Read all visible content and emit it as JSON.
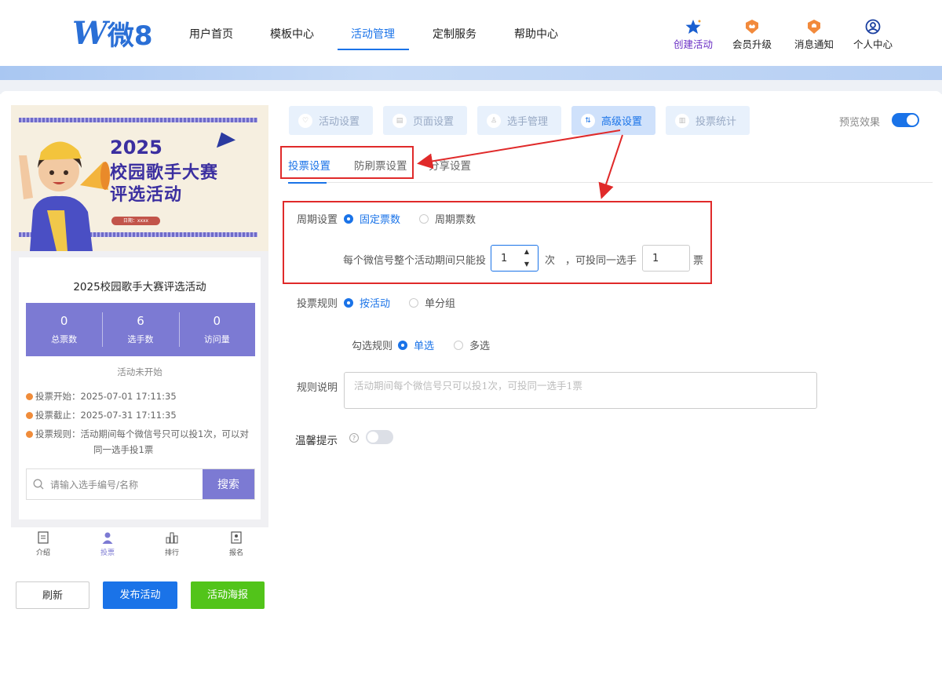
{
  "brand": {
    "logo_w": "W",
    "logo_text": "微8"
  },
  "nav": {
    "links": [
      "用户首页",
      "模板中心",
      "活动管理",
      "定制服务",
      "帮助中心"
    ],
    "active": "活动管理",
    "icons": [
      {
        "label": "创建活动",
        "icon": "star-icon"
      },
      {
        "label": "会员升级",
        "icon": "crown-badge-icon"
      },
      {
        "label": "消息通知",
        "icon": "bell-badge-icon"
      },
      {
        "label": "个人中心",
        "icon": "user-icon"
      }
    ]
  },
  "preview": {
    "poster": {
      "line1": "2025",
      "line2": "校园歌手大赛",
      "line3": "评选活动",
      "date": "日期：xxxx"
    },
    "title": "2025校园歌手大赛评选活动",
    "stats": [
      {
        "num": "0",
        "label": "总票数"
      },
      {
        "num": "6",
        "label": "选手数"
      },
      {
        "num": "0",
        "label": "访问量"
      }
    ],
    "status": "活动未开始",
    "meta": {
      "start": "投票开始：2025-07-01 17:11:35",
      "end": "投票截止：2025-07-31 17:11:35",
      "rule_a": "投票规则：活动期间每个微信号只可以投1次，可以对",
      "rule_b": "同一选手投1票"
    },
    "search_placeholder": "请输入选手编号/名称",
    "search_button": "搜索",
    "tabbar": [
      "介绍",
      "投票",
      "排行",
      "报名"
    ]
  },
  "buttons": {
    "refresh": "刷新",
    "publish": "发布活动",
    "poster": "活动海报"
  },
  "colors": {
    "accent": "#1a73e8",
    "purple": "#7c7ad3",
    "green": "#52c41a",
    "red": "#e02a2a"
  },
  "steps": [
    "活动设置",
    "页面设置",
    "选手管理",
    "高级设置",
    "投票统计"
  ],
  "steps_active": "高级设置",
  "preview_toggle": {
    "label": "预览效果",
    "on": true
  },
  "subtabs": [
    "投票设置",
    "防刷票设置",
    "分享设置"
  ],
  "form": {
    "cycle_label": "周期设置",
    "cycle_options": [
      "固定票数",
      "周期票数"
    ],
    "limit_prefix": "每个微信号整个活动期间只能投",
    "limit_value": "1",
    "limit_unit": "次",
    "same_prefix": "，可投同一选手",
    "same_value": "1",
    "same_unit": "票",
    "rule_label": "投票规则",
    "rule_options": [
      "按活动",
      "单分组"
    ],
    "check_label": "勾选规则",
    "check_options": [
      "单选",
      "多选"
    ],
    "desc_label": "规则说明",
    "desc_placeholder": "活动期间每个微信号只可以投1次，可投同一选手1票",
    "tip_label": "温馨提示",
    "tip_on": false
  }
}
